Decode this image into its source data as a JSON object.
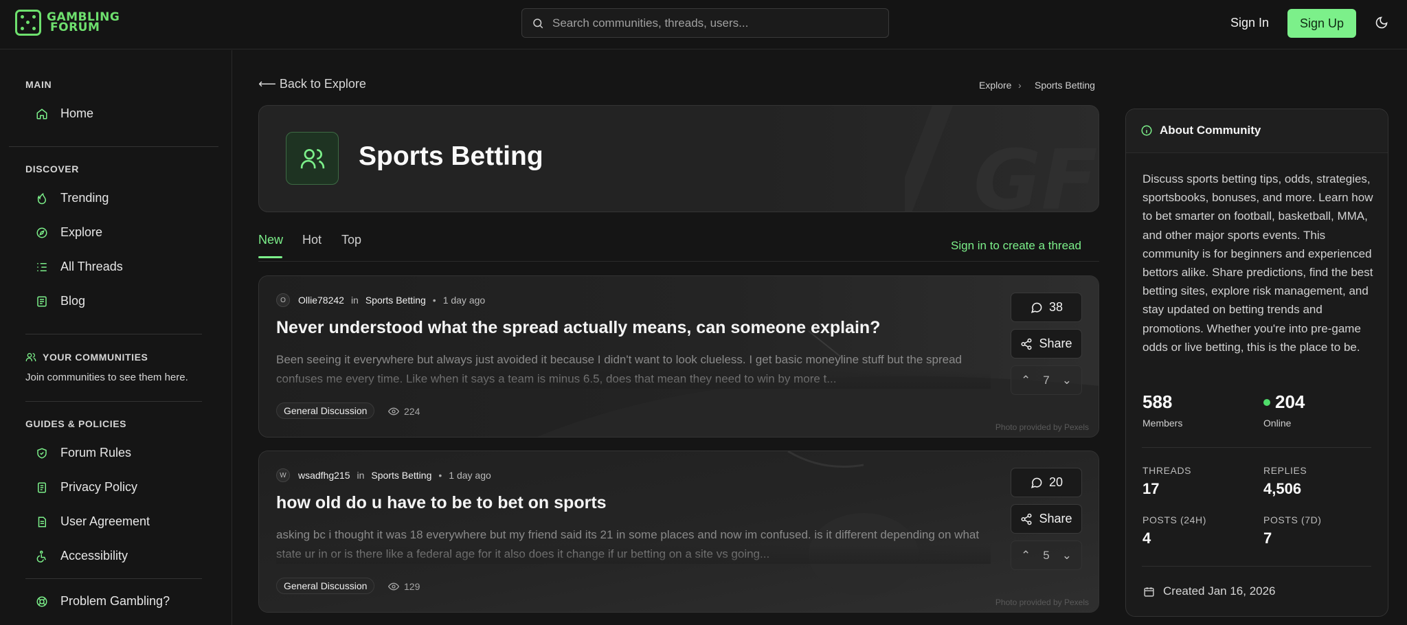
{
  "header": {
    "logo_line1": "GAMBLING",
    "logo_line2": "FORUM",
    "search_placeholder": "Search communities, threads, users...",
    "sign_in": "Sign In",
    "sign_up": "Sign Up",
    "theme_icon": "moon-icon",
    "accent_color": "#7cf08a"
  },
  "sidebar": {
    "main_title": "MAIN",
    "main_items": [
      {
        "label": "Home",
        "icon": "home-icon"
      }
    ],
    "discover_title": "DISCOVER",
    "discover_items": [
      {
        "label": "Trending",
        "icon": "flame-icon"
      },
      {
        "label": "Explore",
        "icon": "compass-icon"
      },
      {
        "label": "All Threads",
        "icon": "list-icon"
      },
      {
        "label": "Blog",
        "icon": "newspaper-icon"
      }
    ],
    "communities_title": "YOUR COMMUNITIES",
    "communities_empty": "Join communities to see them here.",
    "guides_title": "GUIDES & POLICIES",
    "guides_items": [
      {
        "label": "Forum Rules",
        "icon": "shield-icon"
      },
      {
        "label": "Privacy Policy",
        "icon": "document-icon"
      },
      {
        "label": "User Agreement",
        "icon": "file-text-icon"
      },
      {
        "label": "Accessibility",
        "icon": "accessibility-icon"
      }
    ],
    "help_item": {
      "label": "Problem Gambling?",
      "icon": "lifebuoy-icon"
    }
  },
  "main": {
    "back_link": "Back to Explore",
    "breadcrumb": [
      "Explore",
      "Sports Betting"
    ],
    "community_name": "Sports Betting",
    "tabs": [
      "New",
      "Hot",
      "Top"
    ],
    "active_tab": "New",
    "create_thread": "Sign in to create a thread",
    "posts": [
      {
        "avatar_initial": "O",
        "author": "Ollie78242",
        "in_text": "in",
        "community": "Sports Betting",
        "time": "1 day ago",
        "title": "Never understood what the spread actually means, can someone explain?",
        "excerpt": "Been seeing it everywhere but always just avoided it because I didn't want to look clueless. I get basic moneyline stuff but the spread confuses me every time. Like when it says a team is minus 6.5, does that mean they need to win by more t...",
        "tag": "General Discussion",
        "views": "224",
        "comments": "38",
        "share": "Share",
        "score": "7",
        "photo_credit": "Photo provided by Pexels"
      },
      {
        "avatar_initial": "W",
        "author": "wsadfhg215",
        "in_text": "in",
        "community": "Sports Betting",
        "time": "1 day ago",
        "title": "how old do u have to be to bet on sports",
        "excerpt": "asking bc i thought it was 18 everywhere but my friend said its 21 in some places and now im confused. is it different depending on what state ur in or is there like a federal age for it also does it change if ur betting on a site vs going...",
        "tag": "General Discussion",
        "views": "129",
        "comments": "20",
        "share": "Share",
        "score": "5",
        "photo_credit": "Photo provided by Pexels"
      }
    ]
  },
  "about": {
    "title": "About Community",
    "description": "Discuss sports betting tips, odds, strategies, sportsbooks, bonuses, and more. Learn how to bet smarter on football, basketball, MMA, and other major sports events. This community is for beginners and experienced bettors alike. Share predictions, find the best betting sites, explore risk management, and stay updated on betting trends and promotions. Whether you're into pre-game odds or live betting, this is the place to be.",
    "members": "588",
    "members_label": "Members",
    "online": "204",
    "online_label": "Online",
    "threads_label": "THREADS",
    "threads": "17",
    "replies_label": "REPLIES",
    "replies": "4,506",
    "posts24_label": "POSTS (24H)",
    "posts24": "4",
    "posts7_label": "POSTS (7D)",
    "posts7": "7",
    "created": "Created Jan 16, 2026"
  }
}
